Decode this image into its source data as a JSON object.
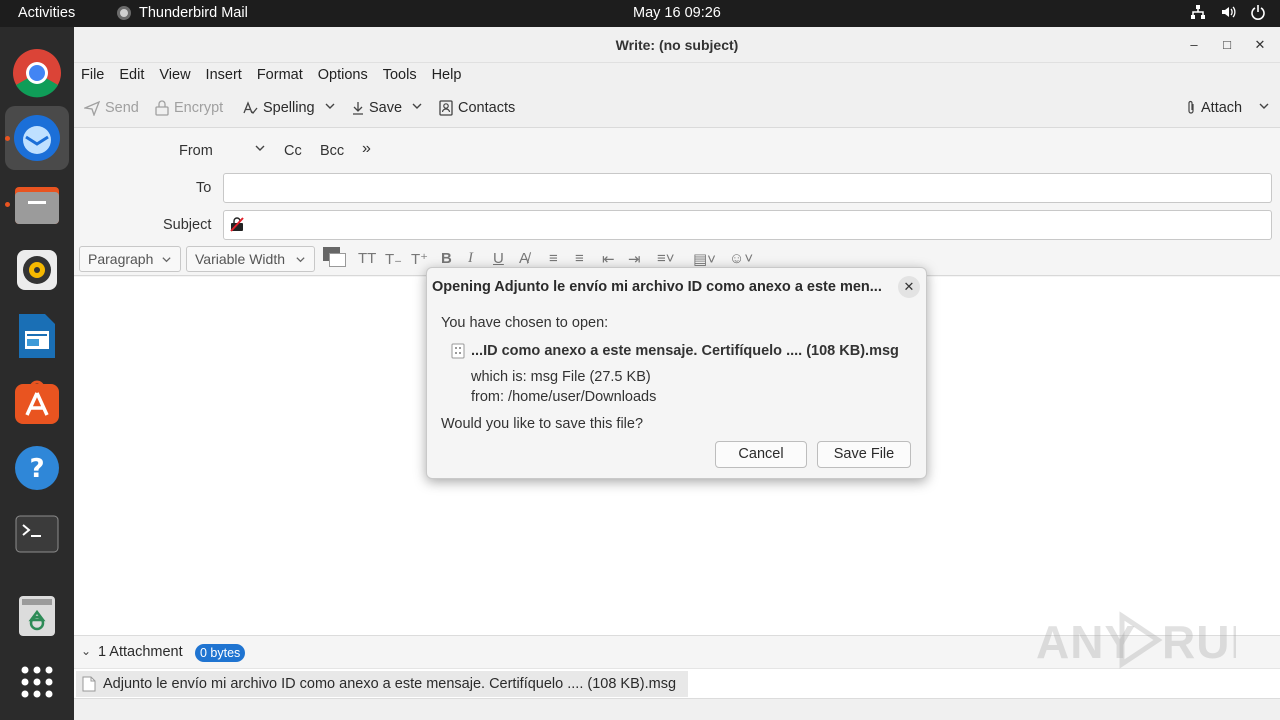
{
  "topbar": {
    "activities": "Activities",
    "app_name": "Thunderbird Mail",
    "clock": "May 16  09:26",
    "icons": [
      "network-icon",
      "volume-icon",
      "power-icon"
    ]
  },
  "dock": {
    "items": [
      "chrome-icon",
      "thunderbird-icon",
      "files-icon",
      "rhythmbox-icon",
      "writer-icon",
      "app-center-icon",
      "help-icon",
      "terminal-icon",
      "trash-icon",
      "app-grid-icon"
    ]
  },
  "window": {
    "title": "Write: (no subject)",
    "menu": [
      "File",
      "Edit",
      "View",
      "Insert",
      "Format",
      "Options",
      "Tools",
      "Help"
    ],
    "toolbar": {
      "send": "Send",
      "encrypt": "Encrypt",
      "spelling": "Spelling",
      "save": "Save",
      "contacts": "Contacts",
      "attach": "Attach"
    },
    "headers": {
      "from_label": "From",
      "cc": "Cc",
      "bcc": "Bcc",
      "to_label": "To",
      "subject_label": "Subject",
      "to_value": "",
      "subject_value": ""
    },
    "format": {
      "paragraph": "Paragraph",
      "font": "Variable Width"
    },
    "attachments": {
      "label": "1 Attachment",
      "size_badge": "0 bytes",
      "file": "Adjunto le envío mi archivo ID como anexo a este mensaje. Certifíquelo .... (108 KB).msg"
    }
  },
  "dialog": {
    "title": "Opening Adjunto le envío mi archivo ID como anexo a este men...",
    "chosen": "You have chosen to open:",
    "filename": "...ID como anexo a este mensaje. Certifíquelo .... (108 KB).msg",
    "which_is": "which is:  msg File (27.5 KB)",
    "from": "from:  /home/user/Downloads",
    "question": "Would you like to save this file?",
    "cancel": "Cancel",
    "save_file": "Save File"
  },
  "watermark": "ANY.RUN",
  "colors": {
    "accent": "#1f74d1",
    "dock_bg": "#2b2b2b",
    "topbar_bg": "#1d1d1d",
    "dock_indicator": "#e95420"
  }
}
